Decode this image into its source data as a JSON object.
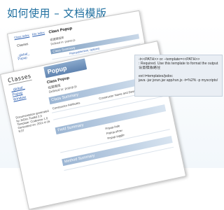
{
  "slide": {
    "title": "如何使用 – 文档模版"
  },
  "code": {
    "lines": [
      "-t<<PATH>> or --template=<<PATH>>",
      ": Required. Use this template to format the output.",
      "设置模版路径",
      "",
      "ext t=templates/jsdoc",
      "java -jar jsrun.jar app/run.js -t=%2% -p myscripts/"
    ]
  },
  "back_page": {
    "title": "Class Popup",
    "subtitle_1": "组建模版库",
    "subtitle_2": "Defined in: popup.js",
    "links": [
      "Class Index",
      "File Index"
    ],
    "left_heading": "Classes",
    "class_list": [
      "_global_",
      "Popup"
    ],
    "bars": [
      "Class Summary",
      "Field Summary"
    ],
    "summary_cell": "Popup(element, options)"
  },
  "front_page": {
    "left_heading": "Classes",
    "class_list": [
      "_global_",
      "Popup",
      "Window"
    ],
    "meta_text": "Documentation generated by JsDoc Toolkit 2.0 Template: Codeview 1.0 Generated on: 2011-4-16 9:37",
    "title": "Popup",
    "class_name": "Class Popup",
    "desc_1": "组建模版",
    "desc_2": "Defined in: popup.js",
    "bars": [
      "Class Summary",
      "Field Summary",
      "Method Summary"
    ],
    "constructor_cell": "Constructor Attributes",
    "constructor_name": "Constructor Name and Description",
    "field_cells": [
      "Popup.hide",
      "Popup.show",
      "Popup.toggle"
    ]
  }
}
